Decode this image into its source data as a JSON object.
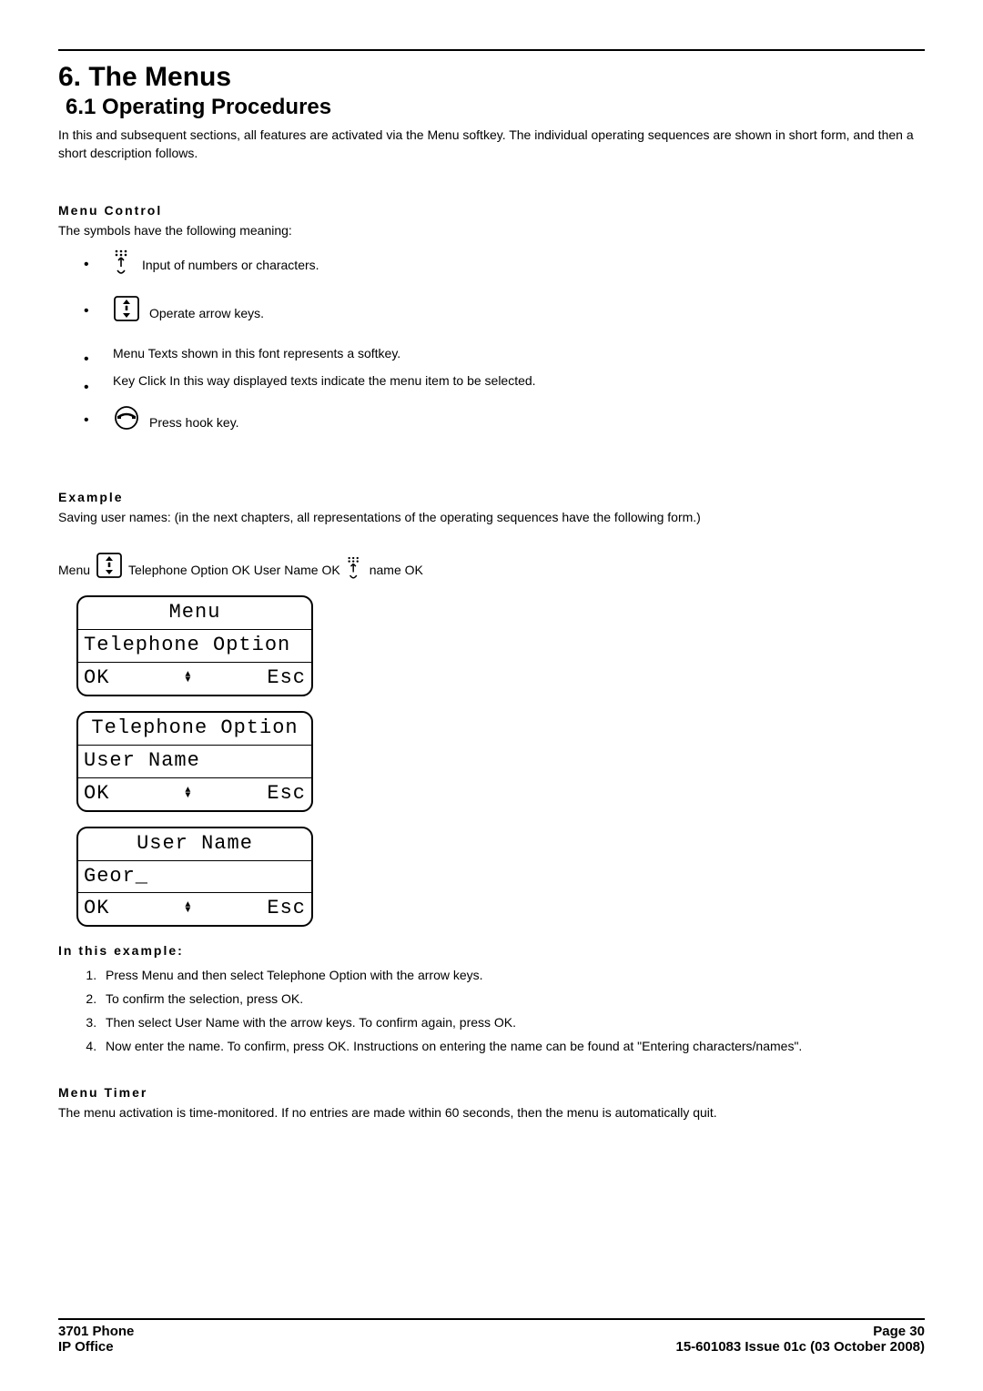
{
  "headings": {
    "h1": "6. The Menus",
    "h2": "6.1 Operating Procedures"
  },
  "intro": "In this and subsequent sections, all features are activated via the Menu softkey. The individual operating sequences are shown in short form, and then a short description follows.",
  "menu_control": {
    "title": "Menu Control",
    "lead": "The symbols have the following meaning:",
    "items": {
      "input": " Input of numbers or characters.",
      "arrows": "Operate arrow keys.",
      "softkey": "Menu Texts shown in this font represents a softkey.",
      "keyclick": "Key Click In this way displayed texts indicate the menu item to be selected.",
      "hook": "Press hook key."
    }
  },
  "example": {
    "title": "Example",
    "lead": "Saving user names: (in the next chapters, all representations of the operating sequences have the following form.)",
    "seq": {
      "p1": "Menu",
      "p2": "Telephone Option OK User Name OK",
      "p3": " name OK"
    }
  },
  "screens": [
    {
      "title": "Menu",
      "value": "Telephone Option",
      "left": "OK",
      "right": "Esc"
    },
    {
      "title": "Telephone Option",
      "value": "User Name",
      "left": "OK",
      "right": "Esc"
    },
    {
      "title": "User Name",
      "value": "Geor_",
      "left": "OK",
      "right": "Esc"
    }
  ],
  "in_example": {
    "title": "In this example:",
    "steps": [
      "Press Menu and then select Telephone Option with the arrow keys.",
      "To confirm the selection, press OK.",
      "Then select User Name with the arrow keys. To confirm again, press OK.",
      "Now enter the name. To confirm, press OK. Instructions on entering the name can be found at \"Entering characters/names\"."
    ]
  },
  "menu_timer": {
    "title": "Menu Timer",
    "text": "The menu activation is time-monitored. If no entries are made within 60 seconds, then the menu is automatically quit."
  },
  "footer": {
    "left1": "3701 Phone",
    "left2": "IP Office",
    "right1": "Page 30",
    "right2": "15-601083 Issue 01c (03 October 2008)"
  }
}
